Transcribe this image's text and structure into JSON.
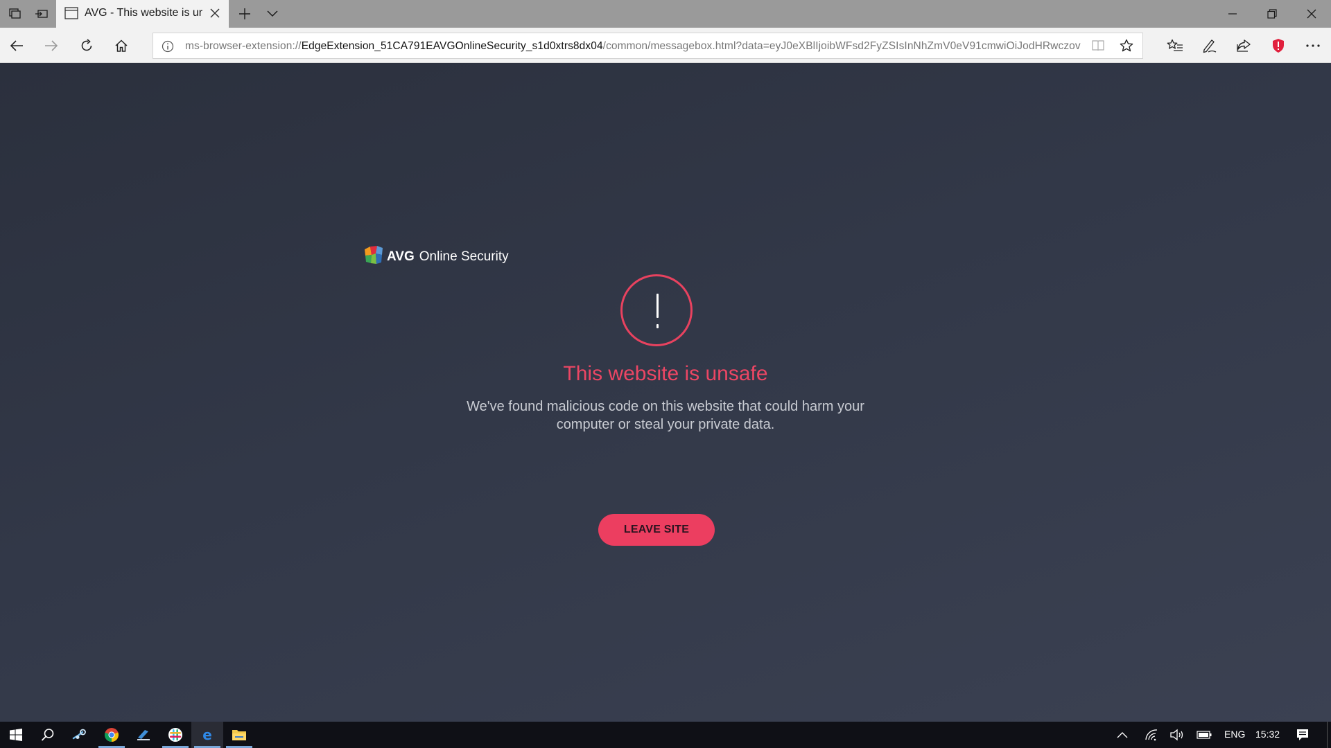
{
  "browser": {
    "tab_title": "AVG - This website is ur",
    "url_prefix": "ms-browser-extension://",
    "url_host": "EdgeExtension_51CA791EAVGOnlineSecurity_s1d0xtrs8dx04",
    "url_rest": "/common/messagebox.html?data=eyJ0eXBlIjoibWFsd2FyZSIsInNhZmV0eV91cmwiOiJodHRwczov",
    "icons": [
      "tab-manager-icon",
      "set-aside-icon",
      "new-tab-icon",
      "tab-list-icon",
      "minimize-icon",
      "restore-icon",
      "close-icon",
      "back-icon",
      "forward-icon",
      "refresh-icon",
      "home-icon",
      "info-icon",
      "reading-view-icon",
      "favorite-star-icon",
      "favorites-hub-icon",
      "pen-icon",
      "share-icon",
      "avg-shield-icon",
      "more-icon"
    ]
  },
  "page": {
    "brand_name": "AVG",
    "brand_product": "Online Security",
    "headline": "This website is unsafe",
    "description": "We've found malicious code on this website that could harm your computer or steal your private data.",
    "leave_button": "LEAVE SITE",
    "accent_color": "#ec4664"
  },
  "taskbar": {
    "language": "ENG",
    "time": "15:32",
    "apps": [
      "start-icon",
      "search-icon",
      "steam-icon",
      "chrome-icon",
      "app-icon",
      "slack-icon",
      "edge-icon",
      "file-explorer-icon"
    ],
    "tray_icons": [
      "show-hidden-icons-icon",
      "wifi-icon",
      "volume-icon",
      "battery-icon",
      "notifications-icon"
    ]
  }
}
